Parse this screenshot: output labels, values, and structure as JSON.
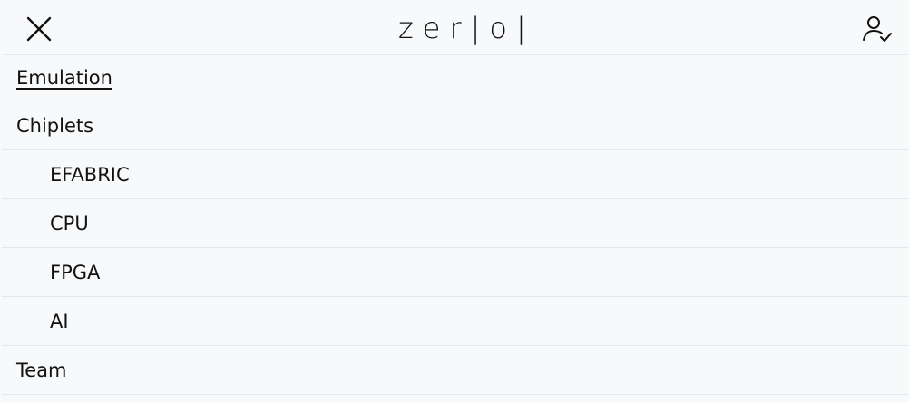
{
  "header": {
    "logo_text": "zer|o|",
    "close_icon": "close-icon",
    "user_icon": "user-check-icon"
  },
  "menu": {
    "items": [
      {
        "label": "Emulation",
        "active": true,
        "level": 0
      },
      {
        "label": "Chiplets",
        "active": false,
        "level": 0
      },
      {
        "label": "EFABRIC",
        "active": false,
        "level": 1
      },
      {
        "label": "CPU",
        "active": false,
        "level": 1
      },
      {
        "label": "FPGA",
        "active": false,
        "level": 1
      },
      {
        "label": "AI",
        "active": false,
        "level": 1
      },
      {
        "label": "Team",
        "active": false,
        "level": 0
      }
    ]
  },
  "colors": {
    "background": "#f8f9fb",
    "text": "#121212",
    "divider": "#e5e7ec"
  }
}
